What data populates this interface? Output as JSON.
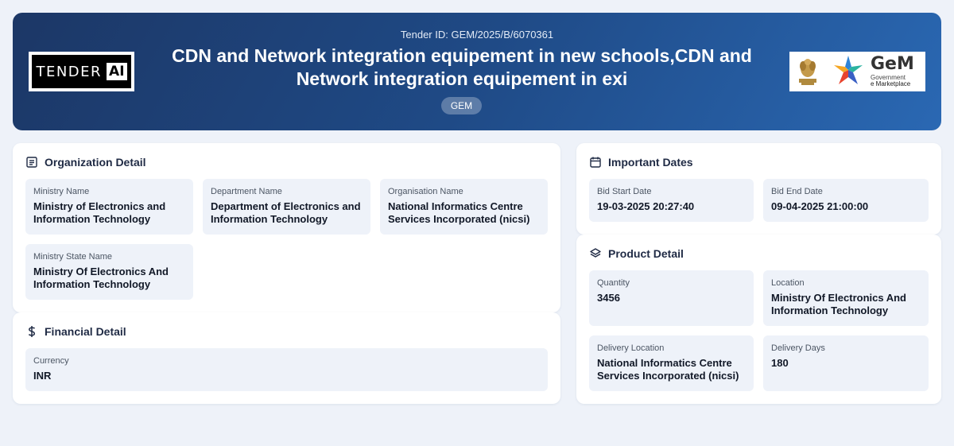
{
  "header": {
    "tender_id": "Tender ID: GEM/2025/B/6070361",
    "title": "CDN and Network integration equipement in new schools,CDN and Network integration equipement in exi",
    "badge": "GEM",
    "tender_logo": {
      "part1": "TENDER",
      "part2": "AI"
    },
    "gem_logo": {
      "name": "GeM",
      "line1": "Government",
      "line2": "e Marketplace"
    }
  },
  "organization": {
    "title": "Organization Detail",
    "icon": "document-icon",
    "fields": [
      {
        "label": "Ministry Name",
        "value": "Ministry of Electronics and Information Technology"
      },
      {
        "label": "Department Name",
        "value": "Department of Electronics and Information Technology"
      },
      {
        "label": "Organisation Name",
        "value": "National Informatics Centre Services Incorporated (nicsi)"
      },
      {
        "label": "Ministry State Name",
        "value": "Ministry Of Electronics And Information Technology"
      }
    ]
  },
  "financial": {
    "title": "Financial Detail",
    "icon": "dollar-icon",
    "fields": [
      {
        "label": "Currency",
        "value": "INR"
      }
    ]
  },
  "dates": {
    "title": "Important Dates",
    "icon": "calendar-icon",
    "fields": [
      {
        "label": "Bid Start Date",
        "value": "19-03-2025 20:27:40"
      },
      {
        "label": "Bid End Date",
        "value": "09-04-2025 21:00:00"
      }
    ]
  },
  "product": {
    "title": "Product Detail",
    "icon": "layers-icon",
    "fields": [
      {
        "label": "Quantity",
        "value": "3456"
      },
      {
        "label": "Location",
        "value": "Ministry Of Electronics And Information Technology"
      },
      {
        "label": "Delivery Location",
        "value": "National Informatics Centre Services Incorporated (nicsi)"
      },
      {
        "label": "Delivery Days",
        "value": "180"
      }
    ]
  },
  "colors": {
    "background": "#eef2f9",
    "header_gradient_start": "#1c3766",
    "header_gradient_end": "#2a68b3",
    "field_bg": "#eef2f9"
  }
}
